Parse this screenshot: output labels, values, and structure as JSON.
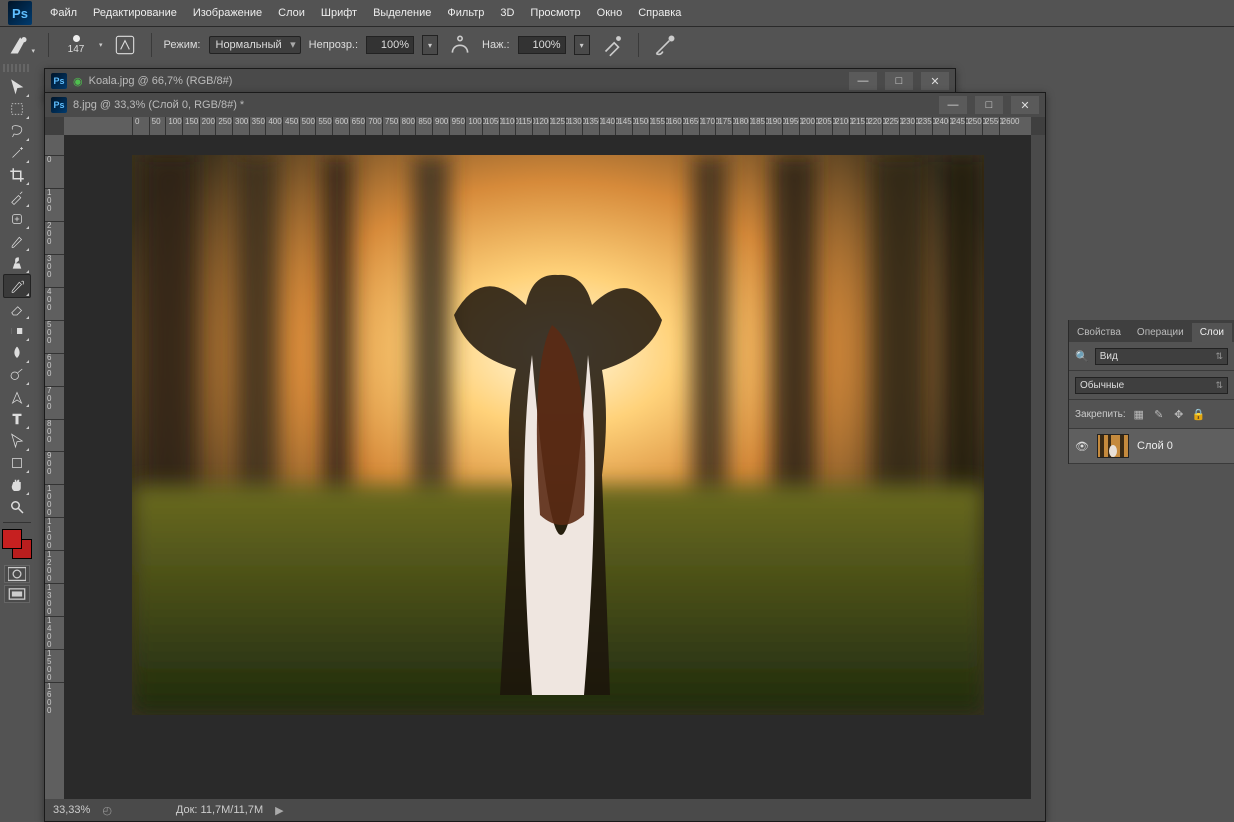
{
  "app": {
    "logo": "Ps"
  },
  "menu": {
    "items": [
      "Файл",
      "Редактирование",
      "Изображение",
      "Слои",
      "Шрифт",
      "Выделение",
      "Фильтр",
      "3D",
      "Просмотр",
      "Окно",
      "Справка"
    ]
  },
  "options": {
    "brush_size": "147",
    "mode_label": "Режим:",
    "mode_value": "Нормальный",
    "opacity_label": "Непрозр.:",
    "opacity_value": "100%",
    "pressure_label": "Наж.:",
    "pressure_value": "100%"
  },
  "ruler_h": [
    0,
    50,
    100,
    150,
    200,
    250,
    300,
    350,
    400,
    450,
    500,
    550,
    600,
    650,
    700,
    750,
    800,
    850,
    900,
    950,
    1000,
    1050,
    1100,
    1150,
    1200,
    1250,
    1300,
    1350,
    1400,
    1450,
    1500,
    1550,
    1600,
    1650,
    1700,
    1750,
    1800,
    1850,
    1900,
    1950,
    2000,
    2050,
    2100,
    2150,
    2200,
    2250,
    2300,
    2350,
    2400,
    2450,
    2500,
    2550,
    2600
  ],
  "ruler_v": [
    0,
    100,
    200,
    300,
    400,
    500,
    600,
    700,
    800,
    900,
    1000,
    1100,
    1200,
    1300,
    1400,
    1500,
    1600
  ],
  "documents": {
    "back": {
      "title": "Koala.jpg @ 66,7% (RGB/8#)"
    },
    "front": {
      "title": "8.jpg @ 33,3% (Слой 0, RGB/8#) *"
    }
  },
  "status": {
    "zoom": "33,33%",
    "doc_label": "Док:",
    "doc_value": "11,7M/11,7M"
  },
  "panels": {
    "tabs": [
      "Свойства",
      "Операции",
      "Слои"
    ],
    "active_tab": 2,
    "filter_value": "Вид",
    "blend_value": "Обычные",
    "lock_label": "Закрепить:",
    "layers": [
      {
        "name": "Слой 0",
        "visible": true
      }
    ]
  }
}
